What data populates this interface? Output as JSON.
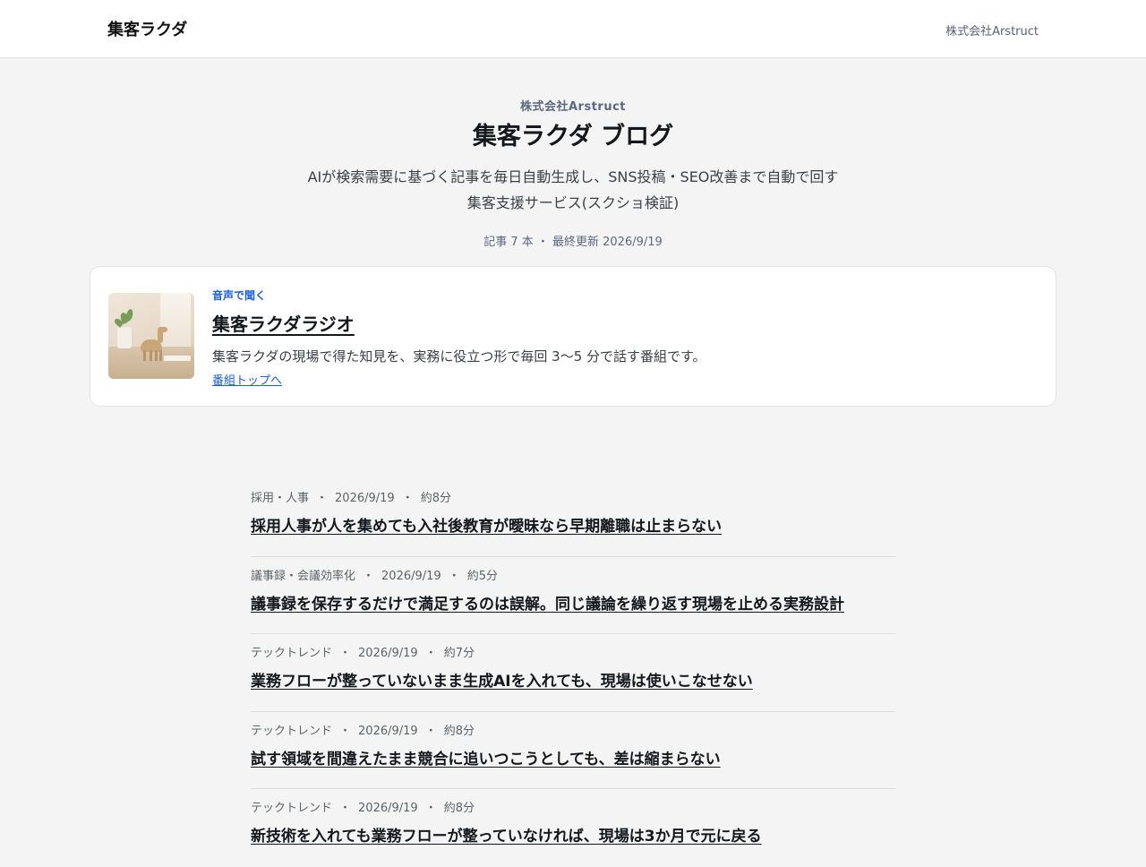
{
  "header": {
    "brand": "集客ラクダ",
    "company": "株式会社Arstruct"
  },
  "hero": {
    "eyebrow": "株式会社Arstruct",
    "title": "集客ラクダ ブログ",
    "description": "AIが検索需要に基づく記事を毎日自動生成し、SNS投稿・SEO改善まで自動で回す集客支援サービス(スクショ検証)",
    "meta": "記事 7 本 ・ 最終更新 2026/9/19"
  },
  "radio": {
    "eyebrow": "音声で聞く",
    "title": "集客ラクダラジオ",
    "description": "集客ラクダの現場で得た知見を、実務に役立つ形で毎回 3〜5 分で話す番組です。",
    "link": "番組トップへ"
  },
  "articles": [
    {
      "category": "採用・人事",
      "date": "2026/9/19",
      "read_time": "約8分",
      "title": "採用人事が人を集めても入社後教育が曖昧なら早期離職は止まらない"
    },
    {
      "category": "議事録・会議効率化",
      "date": "2026/9/19",
      "read_time": "約5分",
      "title": "議事録を保存するだけで満足するのは誤解。同じ議論を繰り返す現場を止める実務設計"
    },
    {
      "category": "テックトレンド",
      "date": "2026/9/19",
      "read_time": "約7分",
      "title": "業務フローが整っていないまま生成AIを入れても、現場は使いこなせない"
    },
    {
      "category": "テックトレンド",
      "date": "2026/9/19",
      "read_time": "約8分",
      "title": "試す領域を間違えたまま競合に追いつこうとしても、差は縮まらない"
    },
    {
      "category": "テックトレンド",
      "date": "2026/9/19",
      "read_time": "約8分",
      "title": "新技術を入れても業務フローが整っていなければ、現場は3か月で元に戻る"
    }
  ]
}
